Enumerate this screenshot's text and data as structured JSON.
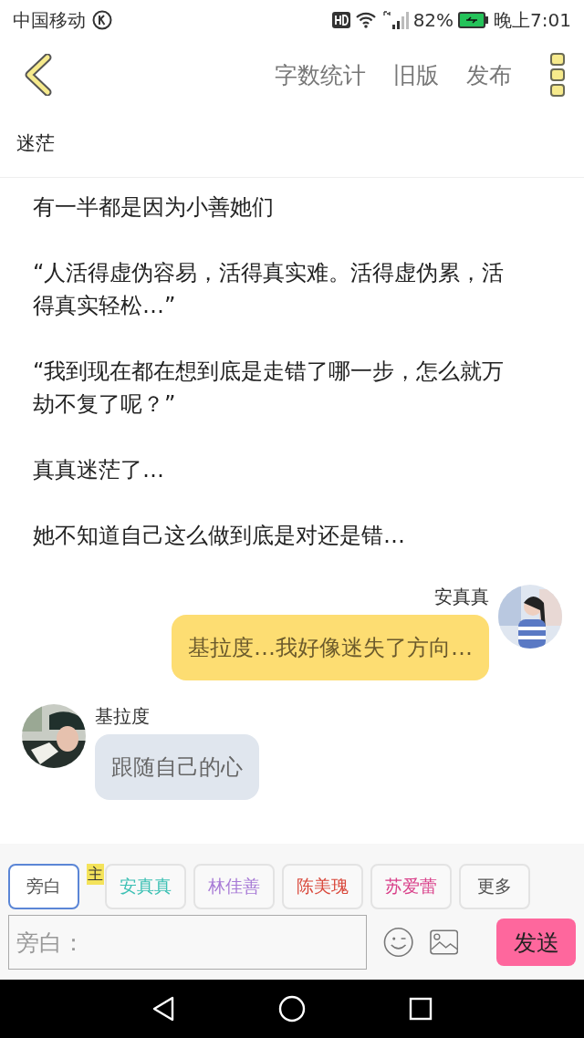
{
  "status_bar": {
    "carrier": "中国移动",
    "battery": "82%",
    "time": "晚上7:01"
  },
  "toolbar": {
    "actions": [
      "字数统计",
      "旧版",
      "发布"
    ]
  },
  "title": "迷茫",
  "paragraphs": [
    "有一半都是因为小善她们",
    "“人活得虚伪容易，活得真实难。活得虚伪累，活得真实轻松…”",
    "“我到现在都在想到底是走错了哪一步，怎么就万劫不复了呢？”",
    "真真迷茫了…",
    "她不知道自己这么做到底是对还是错…"
  ],
  "messages": [
    {
      "kind": "outgoing",
      "name": "安真真",
      "text": "基拉度…我好像迷失了方向…"
    },
    {
      "kind": "incoming",
      "name": "基拉度",
      "text": "跟随自己的心"
    }
  ],
  "roles": [
    {
      "label": "旁白",
      "selected": true,
      "color": "#555555"
    },
    {
      "label": "安真真",
      "selected": false,
      "color": "#3cc0b4",
      "badge": "主"
    },
    {
      "label": "林佳善",
      "selected": false,
      "color": "#a77ad6"
    },
    {
      "label": "陈美瑰",
      "selected": false,
      "color": "#d9483b"
    },
    {
      "label": "苏爱蕾",
      "selected": false,
      "color": "#d9408a"
    },
    {
      "label": "更多",
      "selected": false,
      "color": "#555555"
    }
  ],
  "input": {
    "placeholder": "旁白："
  },
  "send_button": "发送"
}
